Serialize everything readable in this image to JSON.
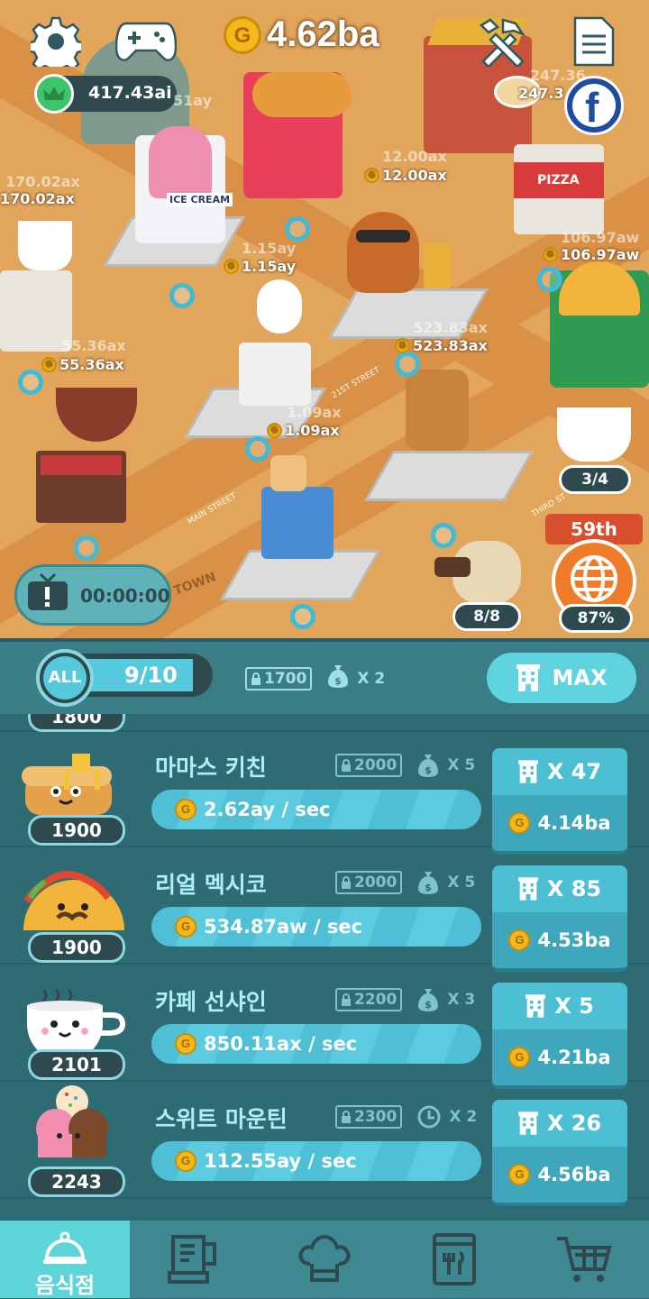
{
  "top_bar": {
    "gold": "4.62ba",
    "gems": "417.43ai",
    "gems_ghost": "51ay"
  },
  "map": {
    "labels": {
      "icecream_left": "170.02ax",
      "icecream_left_ghost": "170.02ax",
      "icecream": "1.15ay",
      "icecream_ghost": "1.15ay",
      "burger": "12.00ax",
      "burger_ghost": "12.00ax",
      "pizza": "247.3",
      "pizza_ghost": "247.36",
      "taco": "106.97aw",
      "taco_ghost": "106.97aw",
      "burger_shop": "523.83ax",
      "burger_shop_ghost": "523.83ax",
      "coffee": "55.36ax",
      "coffee_ghost": "55.36ax",
      "chicken": "1.09ax",
      "chicken_ghost": "1.09ax"
    },
    "signs": {
      "icecream_sign": "ICE CREAM",
      "pizza_sign": "PIZZA",
      "street_21st": "21ST STREET",
      "main_street": "MAIN STREET",
      "third_st": "THIRD ST",
      "town": "TOWN"
    },
    "tv_timer": "00:00:00",
    "coffee_cups": "3/4",
    "explorer": "8/8",
    "globe_rank": "59th",
    "globe_pct": "87%"
  },
  "panel": {
    "all_label": "ALL",
    "progress": "9/10",
    "progress_fraction": 0.9,
    "req_lock": "1700",
    "req_mult": "X 2",
    "max_label": "MAX",
    "peek_level": "1800"
  },
  "rows": [
    {
      "name": "마마스 키친",
      "level": "1900",
      "lock": "2000",
      "mult": "X 5",
      "bonus_icon": "money-bag-icon",
      "rate": "2.62ay / sec",
      "count": "X 47",
      "price": "4.14ba",
      "icon": "pancake-icon"
    },
    {
      "name": "리얼 멕시코",
      "level": "1900",
      "lock": "2000",
      "mult": "X 5",
      "bonus_icon": "money-bag-icon",
      "rate": "534.87aw / sec",
      "count": "X 85",
      "price": "4.53ba",
      "icon": "taco-icon"
    },
    {
      "name": "카페 선샤인",
      "level": "2101",
      "lock": "2200",
      "mult": "X 3",
      "bonus_icon": "money-bag-icon",
      "rate": "850.11ax / sec",
      "count": "X 5",
      "price": "4.21ba",
      "icon": "coffee-cup-icon"
    },
    {
      "name": "스위트 마운틴",
      "level": "2243",
      "lock": "2300",
      "mult": "X 2",
      "bonus_icon": "clock-icon",
      "rate": "112.55ay / sec",
      "count": "X 26",
      "price": "4.56ba",
      "icon": "ice-cream-icon"
    }
  ],
  "nav": [
    {
      "label": "음식점",
      "icon": "restaurant-cloche-icon"
    },
    {
      "label": "",
      "icon": "blender-icon"
    },
    {
      "label": "",
      "icon": "chef-hat-icon"
    },
    {
      "label": "",
      "icon": "menu-book-icon"
    },
    {
      "label": "",
      "icon": "shopping-cart-icon"
    }
  ],
  "colors": {
    "map_bg": "#e2a55c",
    "panel_bg": "#2f6b73",
    "accent": "#4cbfd3",
    "gold": "#f4b81d"
  }
}
